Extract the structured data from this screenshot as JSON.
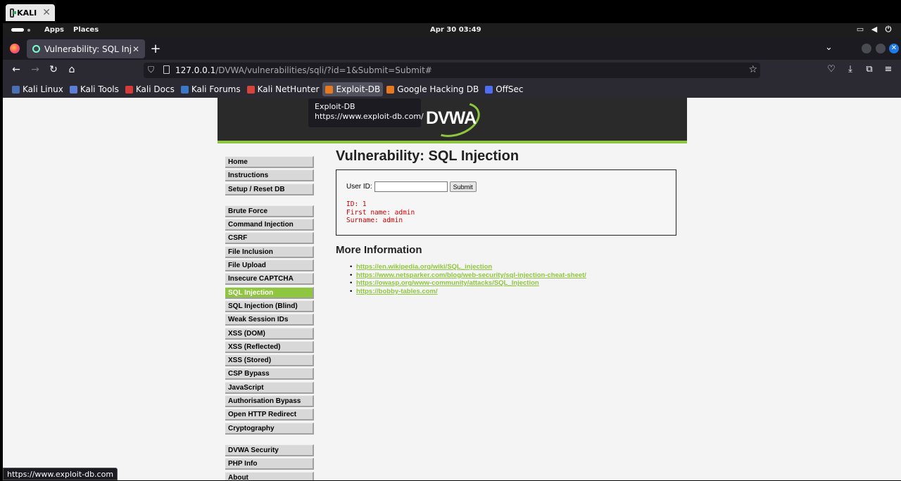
{
  "vm": {
    "tab_label": "KALI",
    "close": "✕"
  },
  "panel": {
    "apps": "Apps",
    "places": "Places",
    "clock": "Apr 30  03:49"
  },
  "browser": {
    "tab_title": "Vulnerability: SQL Injection",
    "tab_close": "✕",
    "new_tab": "+",
    "url_host": "127.0.0.1",
    "url_path": "/DVWA/vulnerabilities/sqli/?id=1&Submit=Submit#",
    "bookmarks": [
      {
        "label": "Kali Linux",
        "color": "#4a6fb5"
      },
      {
        "label": "Kali Tools",
        "color": "#5b7fd6"
      },
      {
        "label": "Kali Docs",
        "color": "#d73a3a"
      },
      {
        "label": "Kali Forums",
        "color": "#3a78c9"
      },
      {
        "label": "Kali NetHunter",
        "color": "#d7443a"
      },
      {
        "label": "Exploit-DB",
        "color": "#e8791f"
      },
      {
        "label": "Google Hacking DB",
        "color": "#e8791f"
      },
      {
        "label": "OffSec",
        "color": "#4f6ef0"
      }
    ],
    "tooltip_title": "Exploit-DB",
    "tooltip_url": "https://www.exploit-db.com/",
    "status_url": "https://www.exploit-db.com"
  },
  "dvwa": {
    "logo_text": "DVWA",
    "menu_group1": [
      "Home",
      "Instructions",
      "Setup / Reset DB"
    ],
    "menu_group2": [
      "Brute Force",
      "Command Injection",
      "CSRF",
      "File Inclusion",
      "File Upload",
      "Insecure CAPTCHA",
      "SQL Injection",
      "SQL Injection (Blind)",
      "Weak Session IDs",
      "XSS (DOM)",
      "XSS (Reflected)",
      "XSS (Stored)",
      "CSP Bypass",
      "JavaScript",
      "Authorisation Bypass",
      "Open HTTP Redirect",
      "Cryptography"
    ],
    "menu_group3": [
      "DVWA Security",
      "PHP Info",
      "About"
    ],
    "selected_item": "SQL Injection",
    "heading": "Vulnerability: SQL Injection",
    "user_id_label": "User ID:",
    "user_id_value": "",
    "submit_label": "Submit",
    "result": "ID: 1\nFirst name: admin\nSurname: admin",
    "more_info_heading": "More Information",
    "links": [
      "https://en.wikipedia.org/wiki/SQL_injection",
      "https://www.netsparker.com/blog/web-security/sql-injection-cheat-sheet/",
      "https://owasp.org/www-community/attacks/SQL_Injection",
      "https://bobby-tables.com/"
    ]
  },
  "colors": {
    "accent": "#8fc63f",
    "result_text": "#cc0000",
    "browser_chrome": "#2b2a33"
  }
}
